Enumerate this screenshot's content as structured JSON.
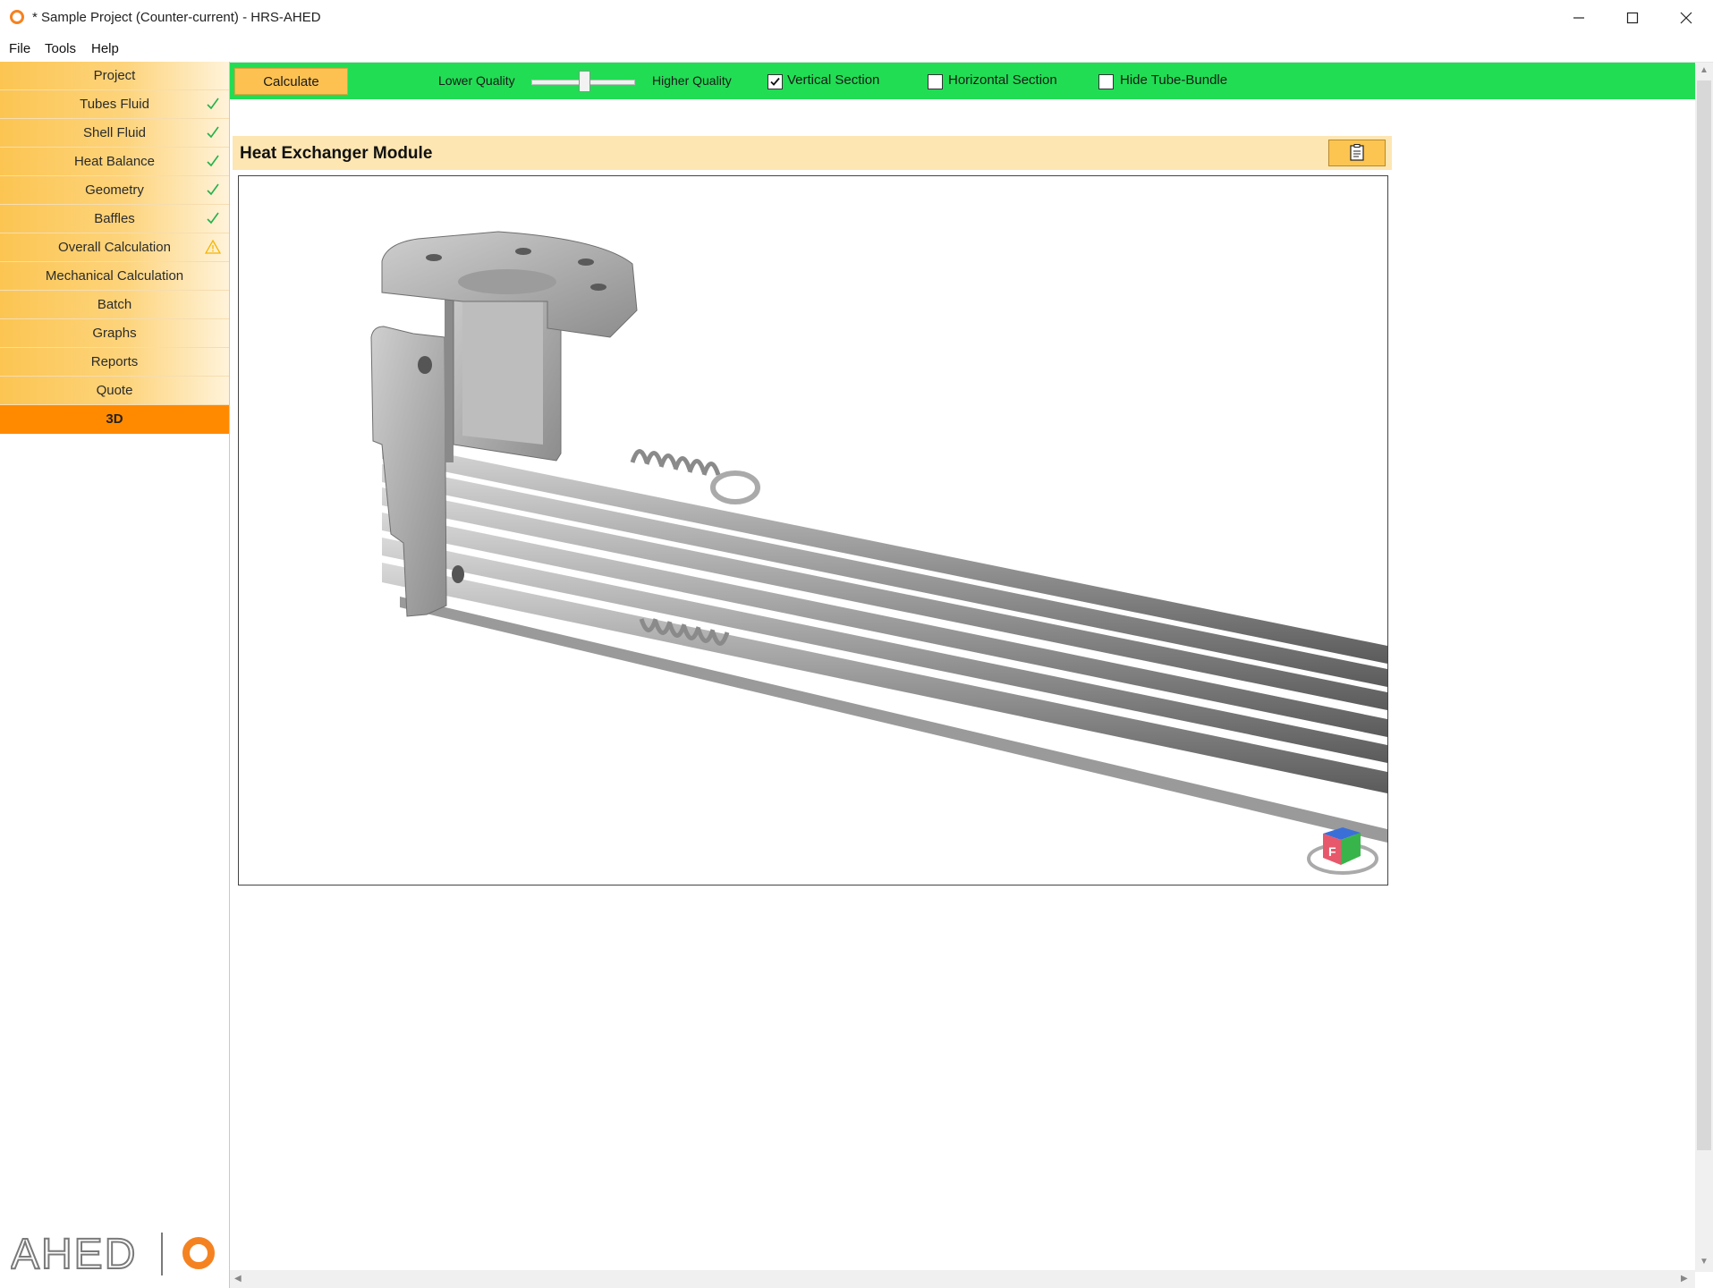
{
  "window": {
    "title": "* Sample Project (Counter-current) - HRS-AHED",
    "controls": [
      "minimize-icon",
      "maximize-icon",
      "close-icon"
    ]
  },
  "menu": {
    "items": [
      "File",
      "Tools",
      "Help"
    ]
  },
  "sidebar": {
    "items": [
      {
        "label": "Project",
        "status": ""
      },
      {
        "label": "Tubes Fluid",
        "status": "check-icon"
      },
      {
        "label": "Shell Fluid",
        "status": "check-icon"
      },
      {
        "label": "Heat Balance",
        "status": "check-icon"
      },
      {
        "label": "Geometry",
        "status": "check-icon"
      },
      {
        "label": "Baffles",
        "status": "check-icon"
      },
      {
        "label": "Overall Calculation",
        "status": "warning-icon"
      },
      {
        "label": "Mechanical Calculation",
        "status": ""
      },
      {
        "label": "Batch",
        "status": ""
      },
      {
        "label": "Graphs",
        "status": ""
      },
      {
        "label": "Reports",
        "status": ""
      },
      {
        "label": "Quote",
        "status": ""
      },
      {
        "label": "3D",
        "status": "",
        "active": true
      }
    ],
    "brand": "AHED"
  },
  "toolbar": {
    "calculate_label": "Calculate",
    "lower_quality_label": "Lower Quality",
    "higher_quality_label": "Higher Quality",
    "quality_level": 0.5,
    "vertical_section": {
      "label": "Vertical Section",
      "checked": true
    },
    "horizontal_section": {
      "label": "Horizontal Section",
      "checked": false
    },
    "hide_tube_bundle": {
      "label": "Hide Tube-Bundle",
      "checked": false
    }
  },
  "panel": {
    "title": "Heat Exchanger Module",
    "copy_icon": "clipboard-icon",
    "view_cube_face": "F"
  },
  "colors": {
    "toolbar_bg": "#21dd54",
    "nav_gradient_start": "#fcc552",
    "nav_active": "#ff8a00",
    "panel_header": "#fde6b2",
    "check_green": "#22b14c",
    "warning_yellow": "#f4b400",
    "brand_orange": "#f58220",
    "brand_gray": "#7a7a7a"
  }
}
